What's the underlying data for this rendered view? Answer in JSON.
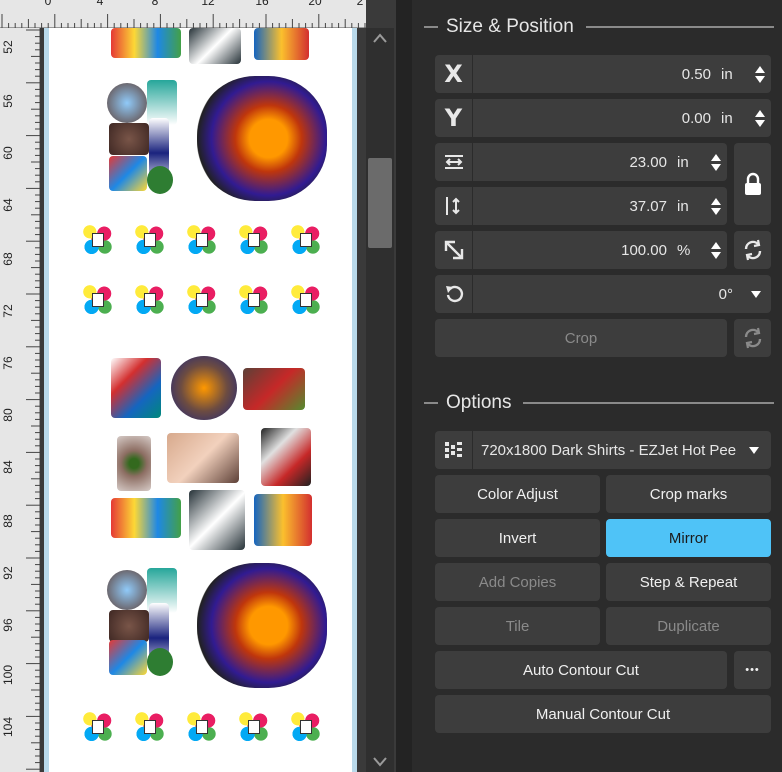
{
  "ruler": {
    "horizontal_labels": [
      "0",
      "4",
      "8",
      "12",
      "16",
      "20",
      "2"
    ],
    "vertical_labels": [
      "52",
      "56",
      "60",
      "64",
      "68",
      "72",
      "76",
      "80",
      "84",
      "88",
      "92",
      "96",
      "100",
      "104"
    ]
  },
  "size_position": {
    "title": "Size & Position",
    "x": {
      "icon": "x-axis-icon",
      "glyph": "X",
      "value": "0.50",
      "unit": "in"
    },
    "y": {
      "icon": "y-axis-icon",
      "glyph": "Y",
      "value": "0.00",
      "unit": "in"
    },
    "width": {
      "icon": "width-arrows-icon",
      "value": "23.00",
      "unit": "in"
    },
    "height": {
      "icon": "height-arrows-icon",
      "value": "37.07",
      "unit": "in"
    },
    "scale": {
      "icon": "diagonal-resize-icon",
      "value": "100.00",
      "unit": "%"
    },
    "rotation": {
      "icon": "rotate-icon",
      "value": "0°"
    },
    "lock_icon": "lock-icon",
    "crop_label": "Crop"
  },
  "options": {
    "title": "Options",
    "preset": "720x1800 Dark Shirts - EZJet Hot Pee...",
    "buttons": {
      "color_adjust": "Color Adjust",
      "crop_marks": "Crop marks",
      "invert": "Invert",
      "mirror": "Mirror",
      "add_copies": "Add Copies",
      "step_repeat": "Step & Repeat",
      "tile": "Tile",
      "duplicate": "Duplicate",
      "auto_contour_cut": "Auto Contour Cut",
      "more": "•••",
      "manual_contour_cut": "Manual Contour Cut"
    }
  },
  "colors": {
    "accent": "#4fc3f7",
    "panel_bg": "#2b2b2b",
    "field_bg": "#3d3d3d"
  }
}
